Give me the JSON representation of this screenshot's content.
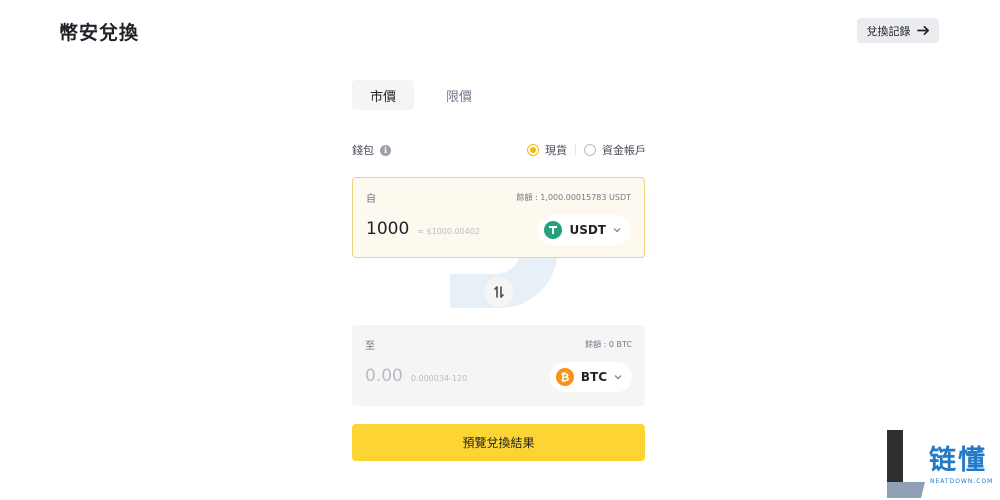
{
  "header": {
    "title": "幣安兌換",
    "history_label": "兌換記錄"
  },
  "tabs": [
    {
      "label": "市價",
      "active": true
    },
    {
      "label": "限價",
      "active": false
    }
  ],
  "wallet": {
    "label": "錢包",
    "options": [
      {
        "label": "現貨",
        "selected": true
      },
      {
        "label": "資金帳戶",
        "selected": false
      }
    ]
  },
  "from": {
    "label": "自",
    "balance": "餘額 : 1,000.00015783 USDT",
    "amount": "1000",
    "amount_sub": "≈ $1000.00402",
    "coin": "USDT"
  },
  "to": {
    "label": "至",
    "balance": "餘額 : 0 BTC",
    "amount": "0.00",
    "amount_sub": "0.000034-120",
    "coin": "BTC"
  },
  "preview_label": "預覽兌換結果",
  "brand": {
    "name": "链懂",
    "url": "NEATDOWN.COM"
  },
  "colors": {
    "accent": "#fcd535",
    "radio_active": "#f0b90b",
    "usdt": "#26a17b",
    "btc": "#f7931a",
    "brand": "#2179c8"
  }
}
